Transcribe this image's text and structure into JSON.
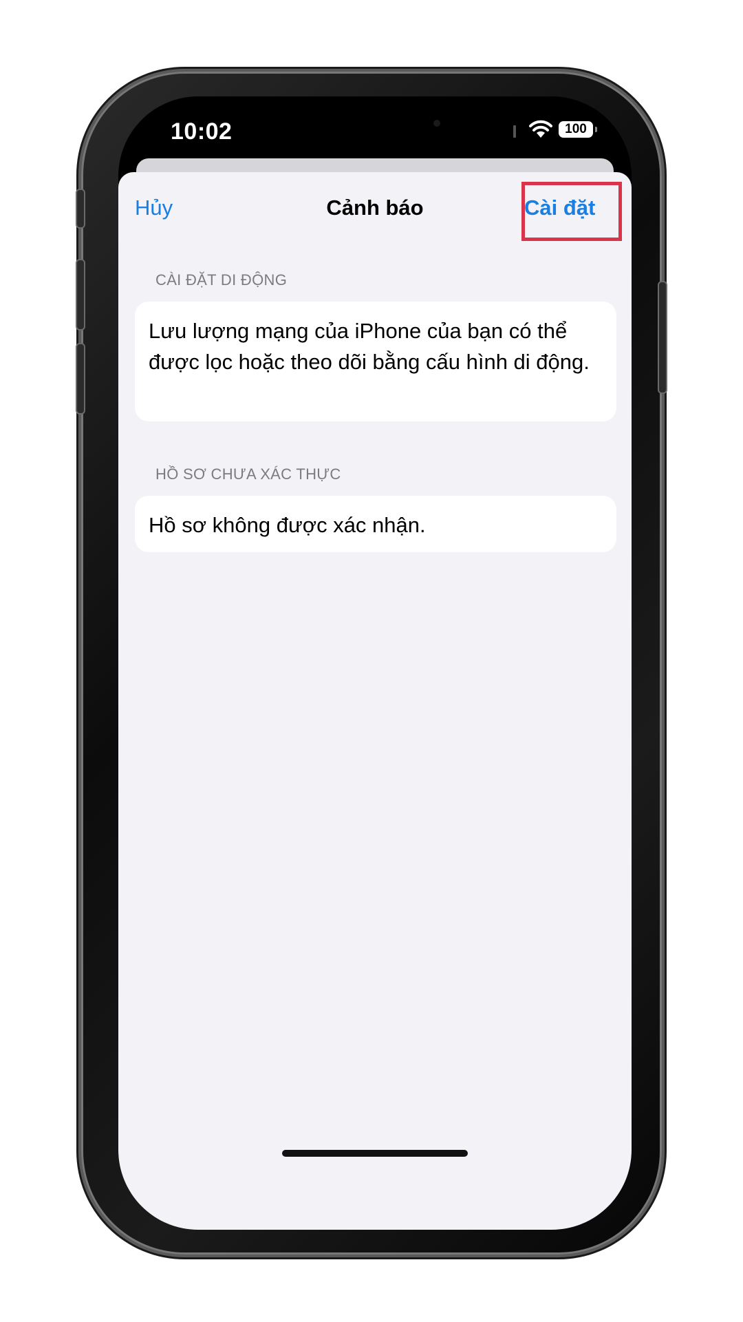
{
  "status_bar": {
    "time": "10:02",
    "battery": "100"
  },
  "nav": {
    "cancel_label": "Hủy",
    "title": "Cảnh báo",
    "install_label": "Cài đặt"
  },
  "sections": [
    {
      "header": "CÀI ĐẶT DI ĐỘNG",
      "body": "Lưu lượng mạng của iPhone của bạn có thể được lọc hoặc theo dõi bằng cấu hình di động."
    },
    {
      "header": "HỒ SƠ CHƯA XÁC THỰC",
      "body": "Hồ sơ không được xác nhận."
    }
  ],
  "colors": {
    "accent": "#1a7fe0",
    "highlight": "#d8344a",
    "sheet_background": "#f2f2f7"
  }
}
